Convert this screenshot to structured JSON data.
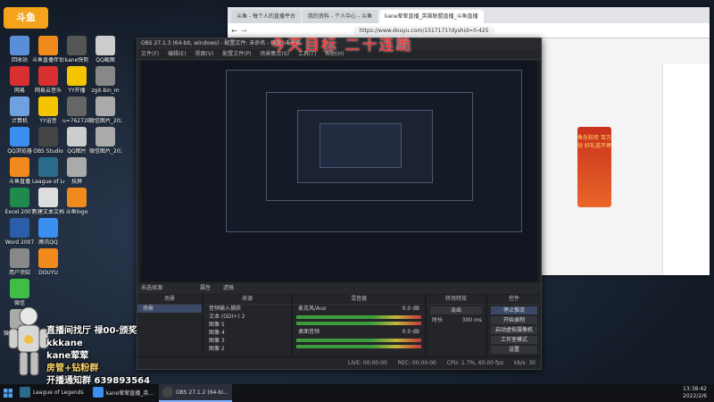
{
  "overlay": {
    "goal_text": "今天目标 二十连跪",
    "live_title": "直播间找厅 禄00-颁奖",
    "streamer_name": "kkkane",
    "wechat": "kane荤荤",
    "room_label": "房管+钻粉群",
    "fan_group": "开播通知群 639893564"
  },
  "desktop": {
    "logo": "斗鱼",
    "icons": [
      {
        "label": "回收站",
        "color": "#5a8fd8"
      },
      {
        "label": "网易",
        "color": "#d83030"
      },
      {
        "label": "计算机",
        "color": "#6fa0e0"
      },
      {
        "label": "QQ浏览器",
        "color": "#3b8ff0"
      },
      {
        "label": "斗鱼直播",
        "color": "#f08a1c"
      },
      {
        "label": "Excel 2007",
        "color": "#1f8a4c"
      },
      {
        "label": "Word 2007",
        "color": "#2b5ea8"
      },
      {
        "label": "用户须知",
        "color": "#888888"
      },
      {
        "label": "微信",
        "color": "#3ebd47"
      },
      {
        "label": "微信图片_20211106",
        "color": "#aaaaaa"
      },
      {
        "label": "斗鱼直播伴侣",
        "color": "#f08a1c"
      },
      {
        "label": "网易云音乐",
        "color": "#d83030"
      },
      {
        "label": "YY语音",
        "color": "#f5c400"
      },
      {
        "label": "OBS Studio",
        "color": "#444444"
      },
      {
        "label": "League of Legends",
        "color": "#2b6c8a"
      },
      {
        "label": "新建文本文档",
        "color": "#dddddd"
      },
      {
        "label": "腾讯QQ",
        "color": "#3b8ff0"
      },
      {
        "label": "DOUYU",
        "color": "#f08a1c"
      },
      {
        "label": "kane快剪",
        "color": "#555555"
      },
      {
        "label": "YY开播",
        "color": "#f5c400"
      },
      {
        "label": "u=76272B",
        "color": "#666666"
      },
      {
        "label": "QQ图片",
        "color": "#cccccc"
      },
      {
        "label": "技屏",
        "color": "#aaaaaa"
      },
      {
        "label": "斗鱼logo",
        "color": "#f08a1c"
      },
      {
        "label": "QQ截图",
        "color": "#cccccc"
      },
      {
        "label": "zgit-bin_m",
        "color": "#888888"
      },
      {
        "label": "微信图片_2021122",
        "color": "#aaaaaa"
      },
      {
        "label": "微信图片_2021120",
        "color": "#aaaaaa"
      }
    ]
  },
  "browser": {
    "tabs": [
      "斗鱼 - 每个人的直播平台",
      "我的资料 - 个人中心 - 斗鱼",
      "kane荤荤直播_英雄联盟直播_斗鱼直播"
    ],
    "url": "https://www.douyu.com/1517171?dyshid=0-425",
    "promo_text": "鱼乐狂欢 百万份 好礼送不停"
  },
  "obs": {
    "title": "OBS 27.1.3 (64-bit, windows) - 配置文件: 未命名 - 场景: 未命名",
    "menu": [
      "文件(F)",
      "编辑(E)",
      "视图(V)",
      "配置文件(P)",
      "场景集合(S)",
      "工具(T)",
      "帮助(H)"
    ],
    "source_bar": {
      "none_selected": "未选择源",
      "properties": "属性",
      "filters": "滤镜"
    },
    "docks": {
      "scenes": {
        "title": "场景",
        "items": [
          "场景"
        ]
      },
      "sources": {
        "title": "来源",
        "items": [
          "音频输入捕获",
          "文本 (GDI+) 2",
          "图像 5",
          "图像 4",
          "图像 3",
          "图像 2",
          "图像"
        ]
      },
      "mixer": {
        "title": "混音器",
        "channels": [
          {
            "name": "麦克风/Aux",
            "db": "0.0 dB"
          },
          {
            "name": "桌面音频",
            "db": "0.0 dB"
          }
        ]
      },
      "transitions": {
        "title": "转场特效",
        "mode": "淡出",
        "duration_label": "时长",
        "duration": "300 ms"
      },
      "controls": {
        "title": "控件",
        "buttons": [
          "停止推流",
          "开始录制",
          "启动虚拟摄像机",
          "工作室模式",
          "设置",
          "退出"
        ]
      }
    },
    "status": {
      "live": "LIVE: 00:00:00",
      "rec": "REC: 00:00:00",
      "cpu": "CPU: 1.7%, 60.00 fps",
      "fps": "kb/s: 30"
    }
  },
  "taskbar": {
    "items": [
      "League of Legends",
      "kane荤荤直播_英...",
      "OBS 27.1.2 (64-bi..."
    ],
    "time": "13:38:42",
    "date": "2022/2/6"
  }
}
